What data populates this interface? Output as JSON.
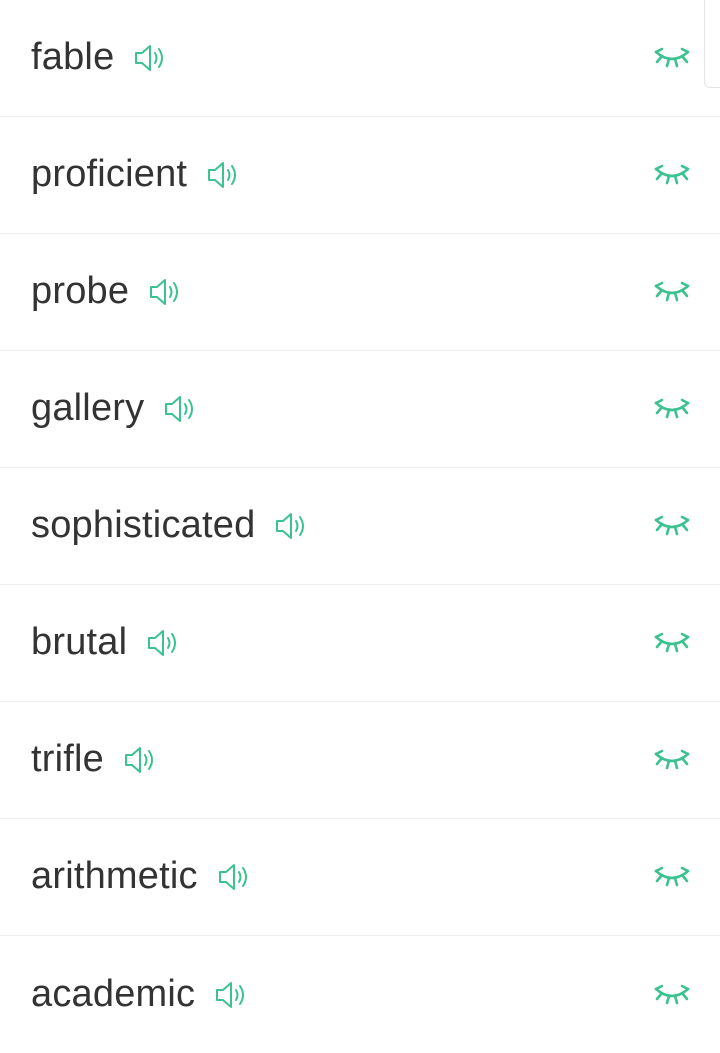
{
  "words": [
    {
      "word": "fable"
    },
    {
      "word": "proficient"
    },
    {
      "word": "probe"
    },
    {
      "word": "gallery"
    },
    {
      "word": "sophisticated"
    },
    {
      "word": "brutal"
    },
    {
      "word": "trifle"
    },
    {
      "word": "arithmetic"
    },
    {
      "word": "academic"
    }
  ],
  "icons": {
    "speaker": "speaker-icon",
    "hidden": "closed-eye-icon"
  },
  "colors": {
    "accent": "#3cc28f",
    "text": "#333333",
    "divider": "#eeeeee"
  }
}
